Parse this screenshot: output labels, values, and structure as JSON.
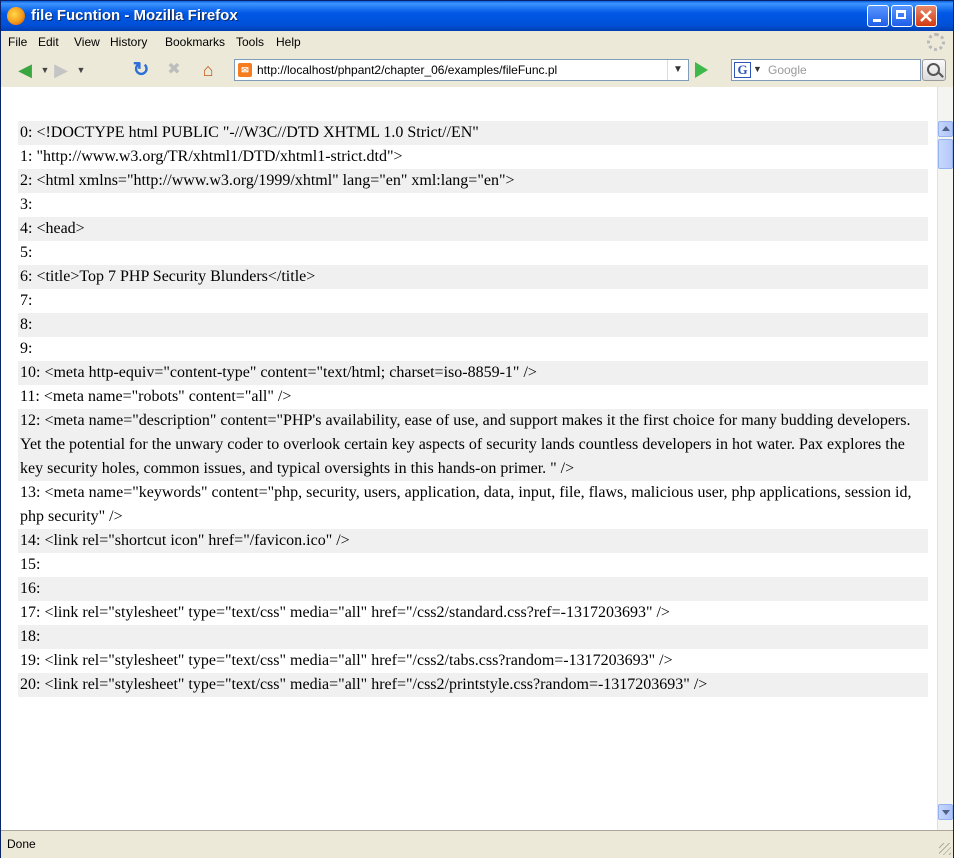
{
  "window": {
    "title": "file Fucntion - Mozilla Firefox"
  },
  "menu": [
    "File",
    "Edit",
    "View",
    "History",
    "Bookmarks",
    "Tools",
    "Help"
  ],
  "navigation": {
    "url": "http://localhost/phpant2/chapter_06/examples/fileFunc.pl",
    "search_placeholder": "Google",
    "search_engine": "G"
  },
  "lines": [
    "0: <!DOCTYPE html PUBLIC \"-//W3C//DTD XHTML 1.0 Strict//EN\"",
    "1: \"http://www.w3.org/TR/xhtml1/DTD/xhtml1-strict.dtd\">",
    "2: <html xmlns=\"http://www.w3.org/1999/xhtml\" lang=\"en\" xml:lang=\"en\">",
    "3:",
    "4: <head>",
    "5:",
    "6: <title>Top 7 PHP Security Blunders</title>",
    "7:",
    "8:",
    "9:",
    "10: <meta http-equiv=\"content-type\" content=\"text/html; charset=iso-8859-1\" />",
    "11: <meta name=\"robots\" content=\"all\" />",
    "12: <meta name=\"description\" content=\"PHP's availability, ease of use, and support makes it the first choice for many budding developers. Yet the potential for the unwary coder to overlook certain key aspects of security lands countless developers in hot water. Pax explores the key security holes, common issues, and typical oversights in this hands-on primer. \" />",
    "13: <meta name=\"keywords\" content=\"php, security, users, application, data, input, file, flaws, malicious user, php applications, session id, php security\" />",
    "14: <link rel=\"shortcut icon\" href=\"/favicon.ico\" />",
    "15:",
    "16:",
    "17: <link rel=\"stylesheet\" type=\"text/css\" media=\"all\" href=\"/css2/standard.css?ref=-1317203693\" />",
    "18:",
    "19: <link rel=\"stylesheet\" type=\"text/css\" media=\"all\" href=\"/css2/tabs.css?random=-1317203693\" />",
    "20: <link rel=\"stylesheet\" type=\"text/css\" media=\"all\" href=\"/css2/printstyle.css?random=-1317203693\" />"
  ],
  "status": {
    "text": "Done"
  },
  "colors": {
    "titlebar": "#0050d8",
    "alt_row": "#f0f0f0"
  }
}
